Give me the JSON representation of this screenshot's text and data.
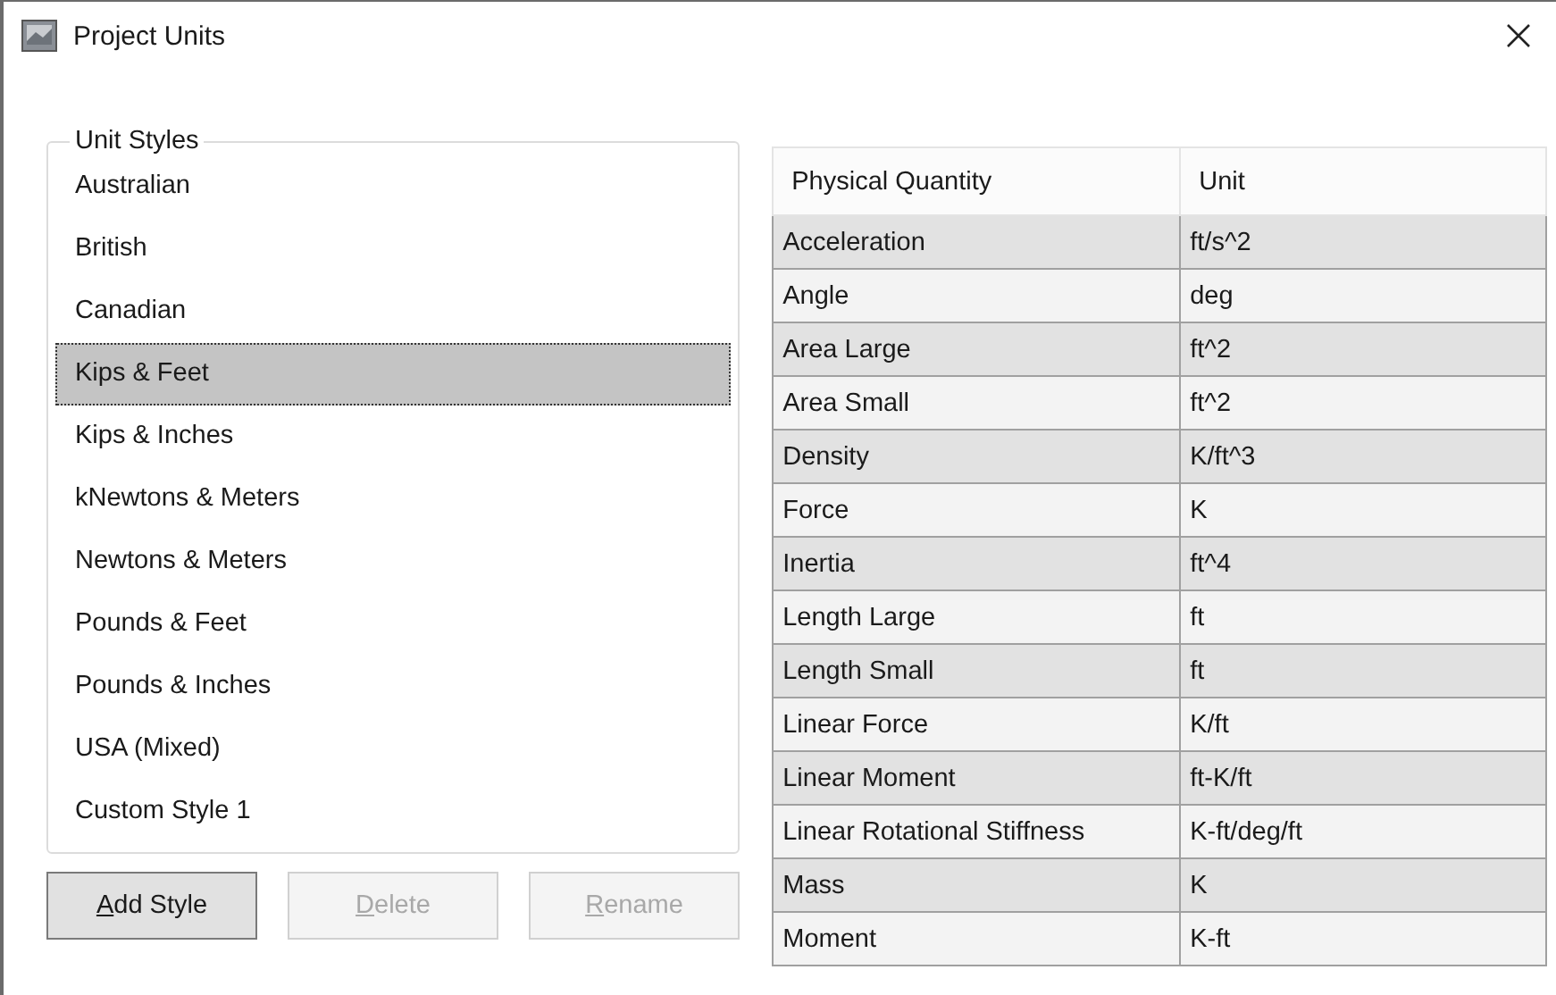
{
  "window": {
    "title": "Project Units"
  },
  "unit_styles": {
    "title": "Unit Styles",
    "items": [
      {
        "label": "Australian",
        "selected": false
      },
      {
        "label": "British",
        "selected": false
      },
      {
        "label": "Canadian",
        "selected": false
      },
      {
        "label": "Kips & Feet",
        "selected": true
      },
      {
        "label": "Kips & Inches",
        "selected": false
      },
      {
        "label": "kNewtons & Meters",
        "selected": false
      },
      {
        "label": "Newtons & Meters",
        "selected": false
      },
      {
        "label": "Pounds & Feet",
        "selected": false
      },
      {
        "label": "Pounds & Inches",
        "selected": false
      },
      {
        "label": "USA (Mixed)",
        "selected": false
      },
      {
        "label": "Custom Style 1",
        "selected": false
      }
    ]
  },
  "buttons": [
    {
      "label": "Add Style",
      "disabled": false
    },
    {
      "label": "Delete",
      "disabled": true
    },
    {
      "label": "Rename",
      "disabled": true
    }
  ],
  "table": {
    "columns": [
      "Physical Quantity",
      "Unit"
    ],
    "rows": [
      [
        "Acceleration",
        "ft/s^2"
      ],
      [
        "Angle",
        "deg"
      ],
      [
        "Area Large",
        "ft^2"
      ],
      [
        "Area Small",
        "ft^2"
      ],
      [
        "Density",
        "K/ft^3"
      ],
      [
        "Force",
        "K"
      ],
      [
        "Inertia",
        "ft^4"
      ],
      [
        "Length Large",
        "ft"
      ],
      [
        "Length Small",
        "ft"
      ],
      [
        "Linear Force",
        "K/ft"
      ],
      [
        "Linear Moment",
        "ft-K/ft"
      ],
      [
        "Linear Rotational Stiffness",
        "K-ft/deg/ft"
      ],
      [
        "Mass",
        "K"
      ],
      [
        "Moment",
        "K-ft"
      ]
    ]
  }
}
